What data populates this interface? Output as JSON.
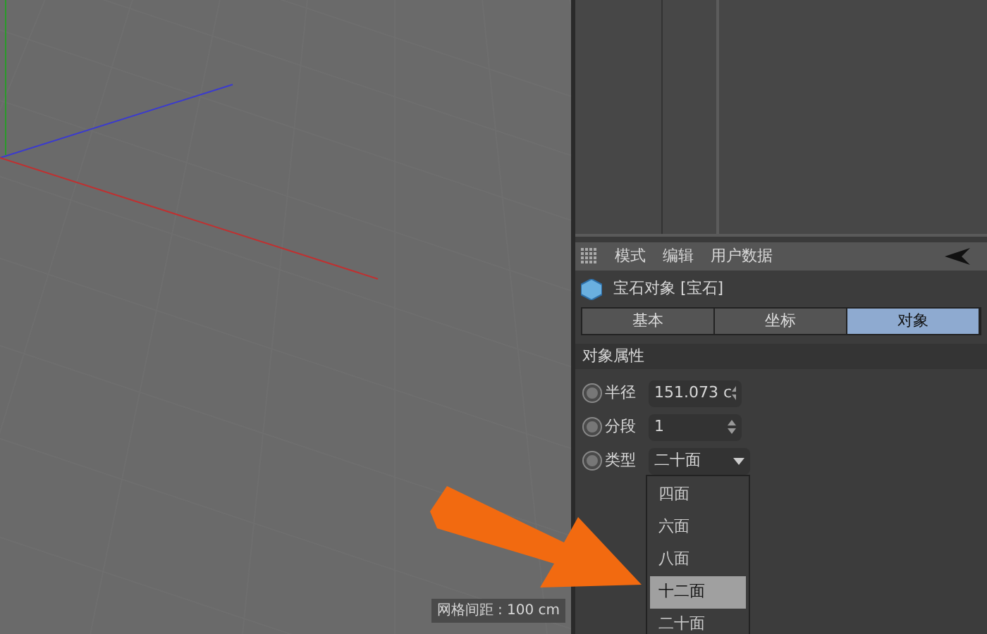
{
  "viewport": {
    "grid_spacing": "网格间距 : 100 cm"
  },
  "attribute_manager": {
    "menu": [
      "模式",
      "编辑",
      "用户数据"
    ],
    "object_title": "宝石对象 [宝石]",
    "tabs": [
      {
        "label": "基本",
        "selected": false
      },
      {
        "label": "坐标",
        "selected": false
      },
      {
        "label": "对象",
        "selected": true
      }
    ],
    "section": "对象属性",
    "fields": [
      {
        "label": "半径",
        "kind": "spinner",
        "value": "151.073 c",
        "checked": false
      },
      {
        "label": "分段",
        "kind": "spinner",
        "value": "1",
        "checked": false
      },
      {
        "label": "类型",
        "kind": "dropdown",
        "value": "二十面",
        "checked": false
      }
    ],
    "dropdown_options": [
      {
        "label": "四面",
        "selected": false
      },
      {
        "label": "六面",
        "selected": false
      },
      {
        "label": "八面",
        "selected": false
      },
      {
        "label": "十二面",
        "selected": true
      },
      {
        "label": "二十面",
        "selected": false
      }
    ]
  }
}
